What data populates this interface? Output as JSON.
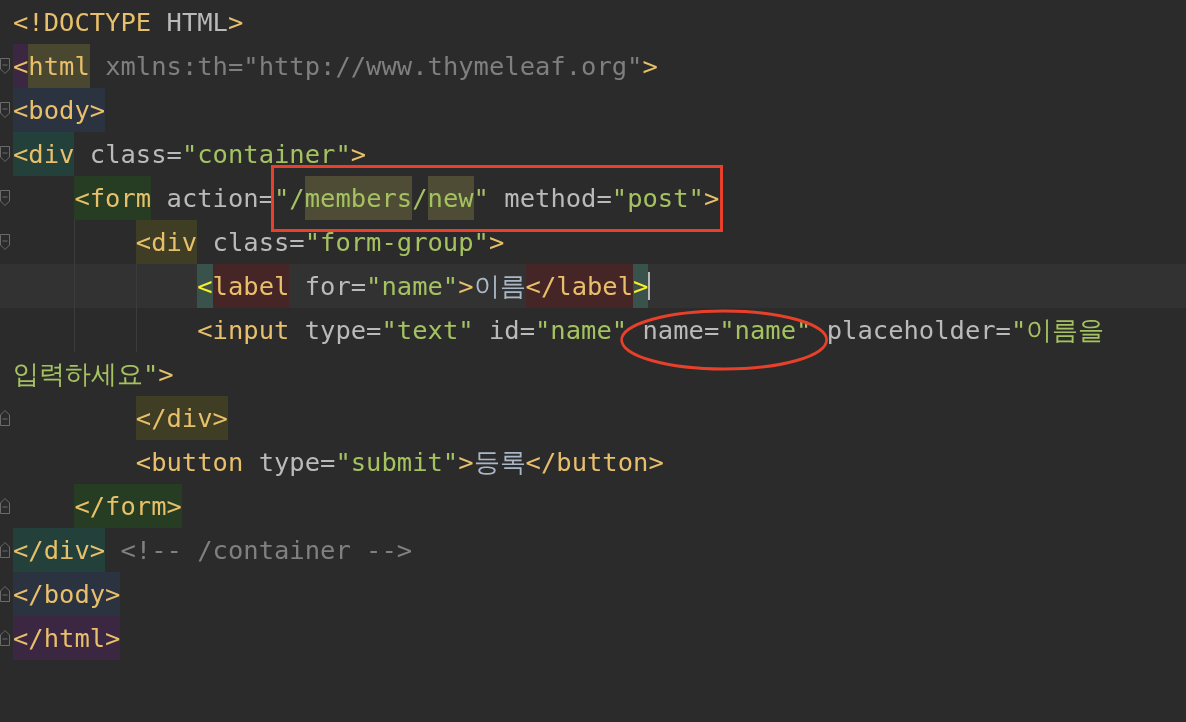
{
  "editor": {
    "lines": [
      {
        "fold_start": false,
        "fold_end": false,
        "current": false,
        "tokens": [
          {
            "kind": "tag",
            "text": "<!DOCTYPE"
          },
          {
            "kind": "attr",
            "text": " HTML"
          },
          {
            "kind": "tag",
            "text": ">"
          }
        ]
      },
      {
        "fold_start": true,
        "fold_end": false,
        "current": false,
        "tokens": [
          {
            "kind": "tag",
            "text": "<",
            "color": "#3b2742"
          },
          {
            "kind": "tag",
            "text": "html",
            "color": "#4a4730"
          },
          {
            "kind": "unused",
            "text": " xmlns:th=\"http://www.thymeleaf.org\""
          },
          {
            "kind": "tag",
            "text": ">"
          }
        ]
      },
      {
        "fold_start": true,
        "fold_end": false,
        "current": false,
        "tokens": [
          {
            "kind": "tag",
            "text": "<body>",
            "color": "#2c3340"
          }
        ]
      },
      {
        "fold_start": true,
        "fold_end": false,
        "current": false,
        "tokens": [
          {
            "kind": "tag",
            "text": "<div",
            "color": "#23403a"
          },
          {
            "kind": "attr",
            "text": " class="
          },
          {
            "kind": "value",
            "text": "\"container\""
          },
          {
            "kind": "tag",
            "text": ">"
          }
        ]
      },
      {
        "fold_start": true,
        "fold_end": false,
        "current": false,
        "tokens": [
          {
            "kind": "indent"
          },
          {
            "kind": "tag",
            "text": "<form",
            "color": "#263d23"
          },
          {
            "kind": "attr",
            "text": " action="
          },
          {
            "kind": "boxed",
            "tokens": [
              {
                "kind": "value",
                "text": "\"/"
              },
              {
                "kind": "value",
                "text": "members",
                "color": "#4f4c35"
              },
              {
                "kind": "value",
                "text": "/"
              },
              {
                "kind": "value",
                "text": "new",
                "color": "#4f4c35"
              },
              {
                "kind": "value",
                "text": "\""
              },
              {
                "kind": "attr",
                "text": " method="
              },
              {
                "kind": "value",
                "text": "\"post\""
              },
              {
                "kind": "tag",
                "text": ">"
              }
            ]
          }
        ]
      },
      {
        "fold_start": true,
        "fold_end": false,
        "current": false,
        "tokens": [
          {
            "kind": "indent"
          },
          {
            "kind": "indent"
          },
          {
            "kind": "tag",
            "text": "<div",
            "color": "#3f3d24"
          },
          {
            "kind": "attr",
            "text": " class="
          },
          {
            "kind": "value",
            "text": "\"form-group\""
          },
          {
            "kind": "tag",
            "text": ">"
          }
        ]
      },
      {
        "fold_start": false,
        "fold_end": false,
        "current": true,
        "tokens": [
          {
            "kind": "indent"
          },
          {
            "kind": "indent"
          },
          {
            "kind": "indent"
          },
          {
            "kind": "bright",
            "text": "<",
            "color": "#3a524c"
          },
          {
            "kind": "tag",
            "text": "label",
            "color": "#452525"
          },
          {
            "kind": "attr",
            "text": " for="
          },
          {
            "kind": "value",
            "text": "\"name\""
          },
          {
            "kind": "tag",
            "text": ">"
          },
          {
            "kind": "text",
            "text": "이름"
          },
          {
            "kind": "tag",
            "text": "</label",
            "color": "#452525"
          },
          {
            "kind": "bright",
            "text": ">",
            "color": "#3a524c"
          }
        ]
      },
      {
        "fold_start": false,
        "fold_end": false,
        "current": false,
        "tokens": [
          {
            "kind": "indent"
          },
          {
            "kind": "indent"
          },
          {
            "kind": "indent"
          },
          {
            "kind": "tag",
            "text": "<input"
          },
          {
            "kind": "attr",
            "text": " type="
          },
          {
            "kind": "value",
            "text": "\"text\""
          },
          {
            "kind": "attr",
            "text": " id="
          },
          {
            "kind": "value",
            "text": "\"name\""
          },
          {
            "kind": "circled",
            "tokens": [
              {
                "kind": "attr",
                "text": " name="
              },
              {
                "kind": "value",
                "text": "\"name\""
              }
            ]
          },
          {
            "kind": "attr",
            "text": " placeholder="
          },
          {
            "kind": "value",
            "text": "\"이름을"
          }
        ]
      },
      {
        "fold_start": false,
        "fold_end": false,
        "current": false,
        "tokens": [
          {
            "kind": "value",
            "text": "입력하세요\""
          },
          {
            "kind": "tag",
            "text": ">"
          }
        ]
      },
      {
        "fold_start": false,
        "fold_end": true,
        "current": false,
        "tokens": [
          {
            "kind": "indent"
          },
          {
            "kind": "indent"
          },
          {
            "kind": "tag",
            "text": "</div>",
            "color": "#3f3d24"
          }
        ]
      },
      {
        "fold_start": false,
        "fold_end": false,
        "current": false,
        "tokens": [
          {
            "kind": "indent"
          },
          {
            "kind": "indent"
          },
          {
            "kind": "tag",
            "text": "<button"
          },
          {
            "kind": "attr",
            "text": " type="
          },
          {
            "kind": "value",
            "text": "\"submit\""
          },
          {
            "kind": "tag",
            "text": ">"
          },
          {
            "kind": "text",
            "text": "등록"
          },
          {
            "kind": "tag",
            "text": "</button>"
          }
        ]
      },
      {
        "fold_start": false,
        "fold_end": true,
        "current": false,
        "tokens": [
          {
            "kind": "indent"
          },
          {
            "kind": "tag",
            "text": "</form>",
            "color": "#263d23"
          }
        ]
      },
      {
        "fold_start": false,
        "fold_end": true,
        "current": false,
        "tokens": [
          {
            "kind": "tag",
            "text": "</div>",
            "color": "#23403a"
          },
          {
            "kind": "comment",
            "text": " <!-- /container -->"
          }
        ]
      },
      {
        "fold_start": false,
        "fold_end": true,
        "current": false,
        "tokens": [
          {
            "kind": "tag",
            "text": "</body>",
            "color": "#2c3340"
          }
        ]
      },
      {
        "fold_start": false,
        "fold_end": true,
        "current": false,
        "tokens": [
          {
            "kind": "tag",
            "text": "</html>",
            "color": "#3b2742"
          }
        ]
      }
    ]
  }
}
